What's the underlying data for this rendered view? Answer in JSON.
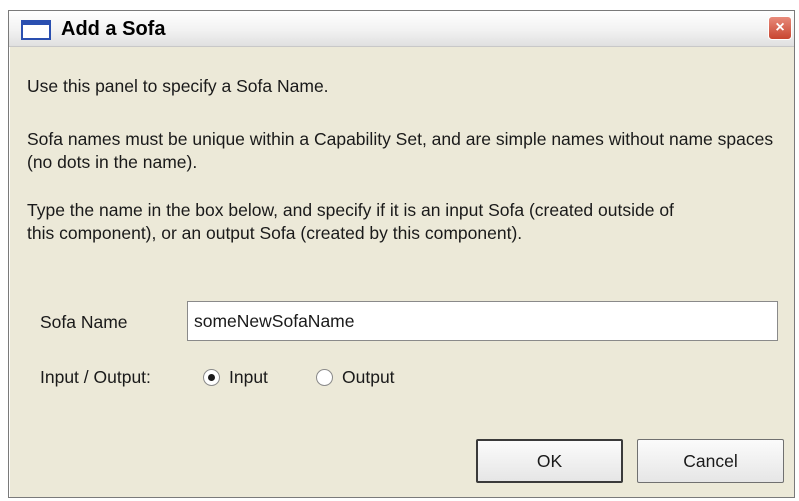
{
  "dialog": {
    "title": "Add a Sofa",
    "close_glyph": "×",
    "intro": "Use this panel to specify a Sofa Name.",
    "rules": "Sofa names must be unique within a Capability Set, and are simple names without name spaces (no dots in the name).",
    "instructions": "Type the name in the box below, and specify if it is an input Sofa (created outside of this component), or an output Sofa (created by this component).",
    "name_label": "Sofa Name",
    "name_value": "someNewSofaName",
    "io_label": "Input / Output:",
    "radio_input_label": "Input",
    "radio_output_label": "Output",
    "selected": "Input",
    "ok_label": "OK",
    "cancel_label": "Cancel"
  },
  "colors": {
    "window_bg": "#ece9d8",
    "close_red": "#c84530",
    "icon_blue": "#2a4fb0"
  }
}
